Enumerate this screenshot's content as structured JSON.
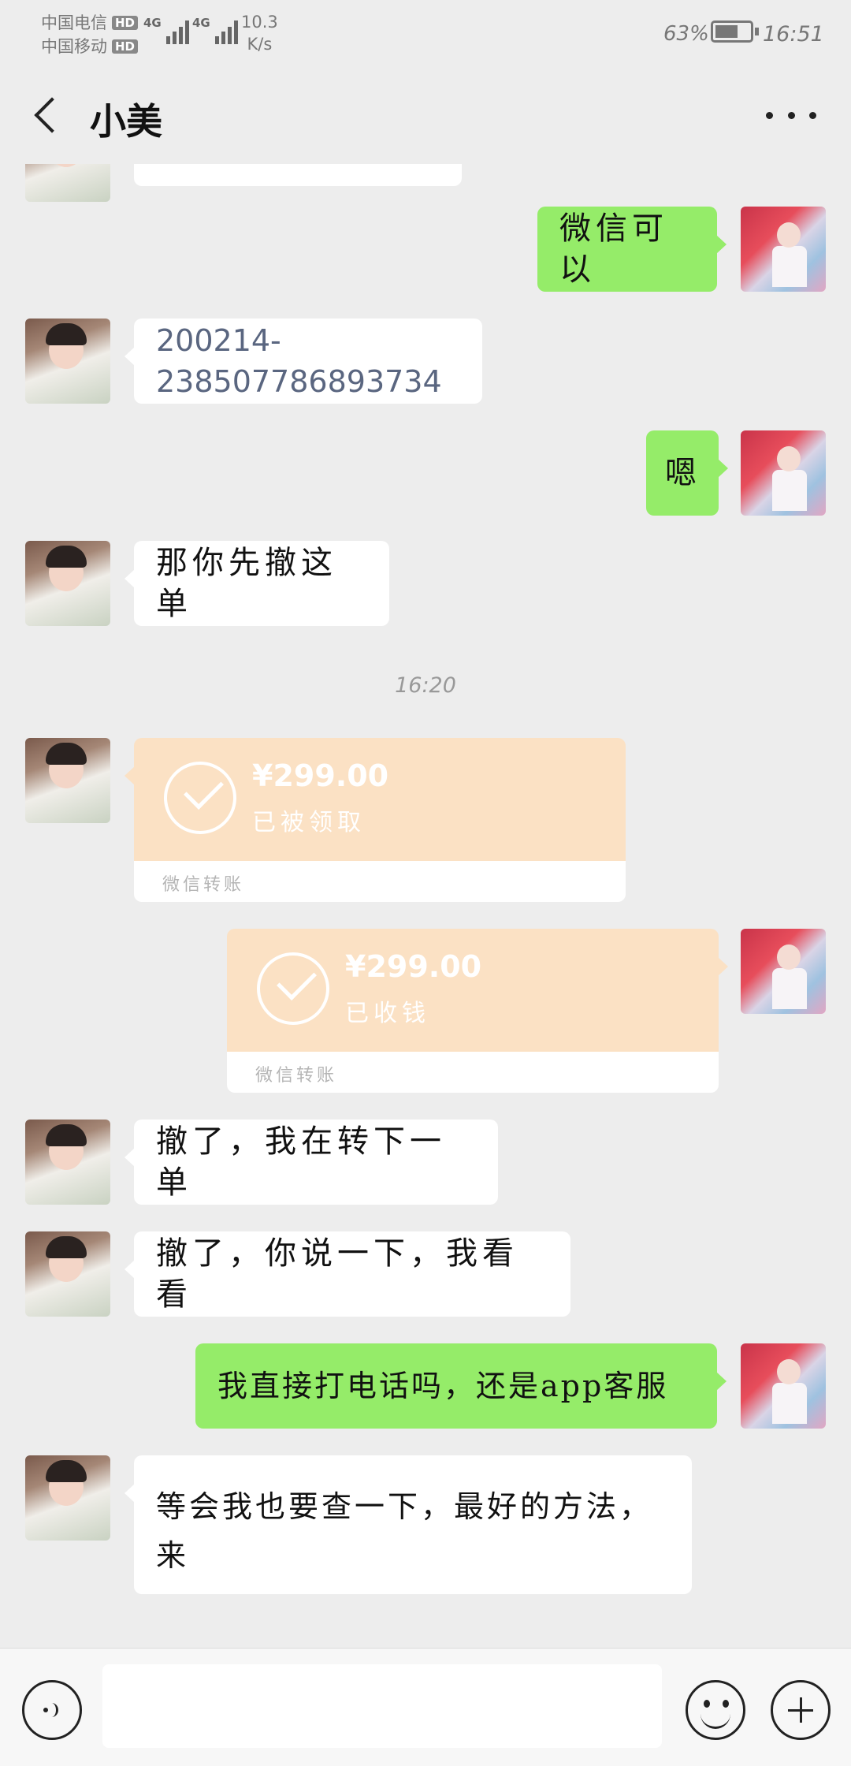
{
  "status_bar": {
    "carrier_1": "中国电信",
    "carrier_2": "中国移动",
    "hd": "HD",
    "network": "4G",
    "speed_value": "10.3",
    "speed_unit": "K/s",
    "battery": "63%",
    "time": "16:51"
  },
  "header": {
    "title": "小美"
  },
  "messages": [
    {
      "side": "right",
      "type": "text",
      "text": "微信可以"
    },
    {
      "side": "left",
      "type": "text",
      "text": "200214-238507786893734"
    },
    {
      "side": "right",
      "type": "text",
      "text": "嗯"
    },
    {
      "side": "left",
      "type": "text",
      "text": "那你先撤这单"
    },
    {
      "type": "timestamp",
      "text": "16:20"
    },
    {
      "side": "left",
      "type": "transfer",
      "amount": "¥299.00",
      "status": "已被领取",
      "label": "微信转账"
    },
    {
      "side": "right",
      "type": "transfer",
      "amount": "¥299.00",
      "status": "已收钱",
      "label": "微信转账"
    },
    {
      "side": "left",
      "type": "text",
      "text": "撤了，我在转下一单"
    },
    {
      "side": "left",
      "type": "text",
      "text": "撤了，你说一下，我看看"
    },
    {
      "side": "right",
      "type": "text",
      "text": "我直接打电话吗，还是app客服"
    },
    {
      "side": "left",
      "type": "text",
      "text": "等会我也要查一下，最好的方法，来"
    }
  ],
  "input": {
    "placeholder": ""
  },
  "colors": {
    "background": "#ededed",
    "my_bubble": "#95ec69",
    "their_bubble": "#ffffff",
    "transfer": "#fbe1c4"
  }
}
